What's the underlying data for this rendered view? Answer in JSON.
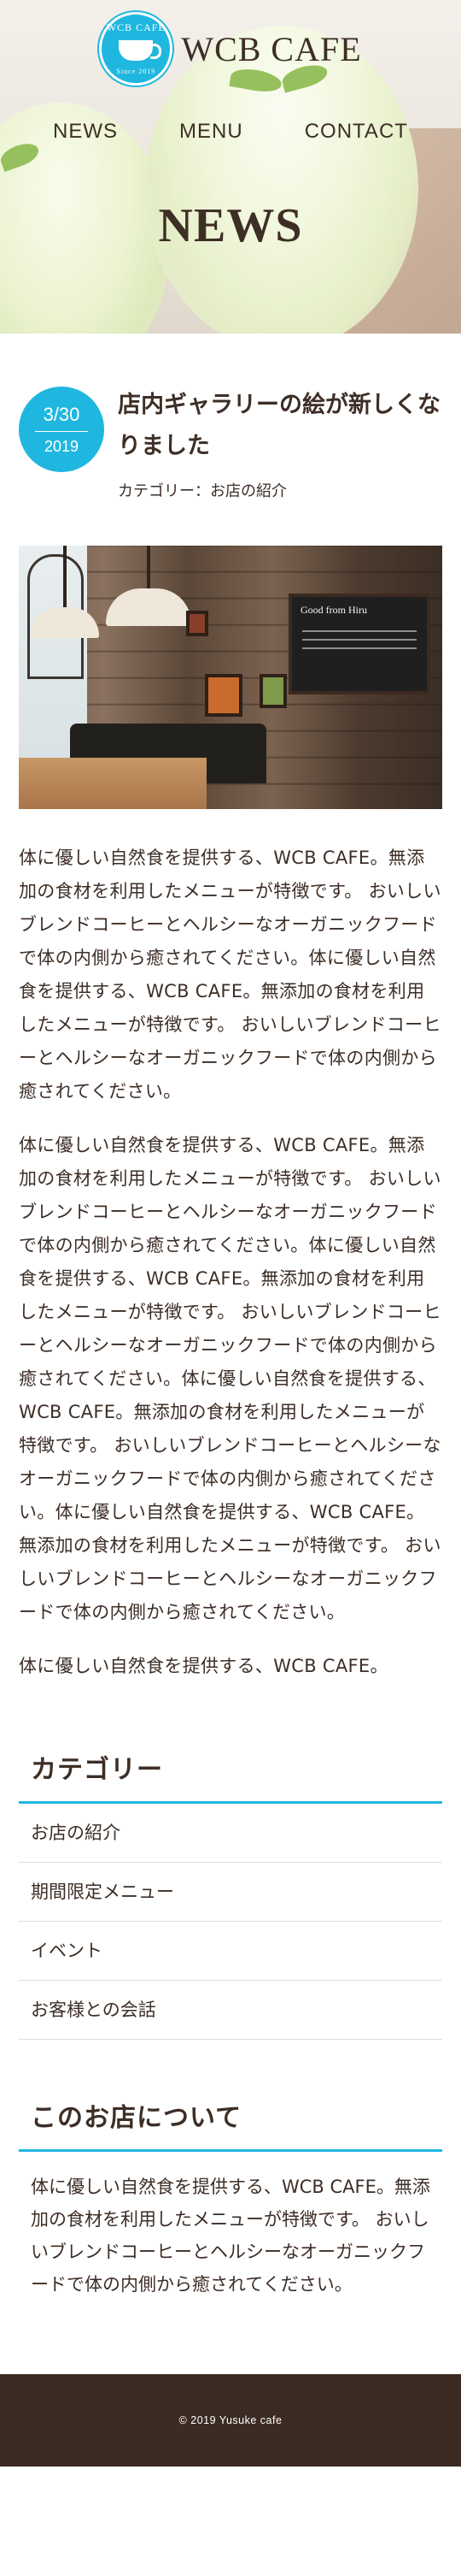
{
  "header": {
    "logo_text": "WCB CAFE",
    "logo_badge_top": "WCB CAFE",
    "logo_badge_bottom": "Since 2019",
    "nav": [
      "NEWS",
      "MENU",
      "CONTACT"
    ],
    "page_title": "NEWS"
  },
  "article": {
    "date_md": "3/30",
    "date_year": "2019",
    "title": "店内ギャラリーの絵が新しくなりました",
    "category_label": "カテゴリー：",
    "category_value": "お店の紹介",
    "photo_sign": "Good from Hiru",
    "paragraphs": [
      "体に優しい自然食を提供する、WCB CAFE。無添加の食材を利用したメニューが特徴です。 おいしいブレンドコーヒーとヘルシーなオーガニックフードで体の内側から癒されてください。体に優しい自然食を提供する、WCB CAFE。無添加の食材を利用したメニューが特徴です。 おいしいブレンドコーヒーとヘルシーなオーガニックフードで体の内側から癒されてください。",
      "体に優しい自然食を提供する、WCB CAFE。無添加の食材を利用したメニューが特徴です。 おいしいブレンドコーヒーとヘルシーなオーガニックフードで体の内側から癒されてください。体に優しい自然食を提供する、WCB CAFE。無添加の食材を利用したメニューが特徴です。 おいしいブレンドコーヒーとヘルシーなオーガニックフードで体の内側から癒されてください。体に優しい自然食を提供する、WCB CAFE。無添加の食材を利用したメニューが特徴です。 おいしいブレンドコーヒーとヘルシーなオーガニックフードで体の内側から癒されてください。体に優しい自然食を提供する、WCB CAFE。無添加の食材を利用したメニューが特徴です。 おいしいブレンドコーヒーとヘルシーなオーガニックフードで体の内側から癒されてください。",
      "体に優しい自然食を提供する、WCB CAFE。"
    ]
  },
  "sidebar": {
    "category_title": "カテゴリー",
    "categories": [
      "お店の紹介",
      "期間限定メニュー",
      "イベント",
      "お客様との会話"
    ],
    "about_title": "このお店について",
    "about_text": "体に優しい自然食を提供する、WCB CAFE。無添加の食材を利用したメニューが特徴です。 おいしいブレンドコーヒーとヘルシーなオーガニックフードで体の内側から癒されてください。"
  },
  "footer": {
    "copyright": "© 2019 Yusuke cafe"
  },
  "colors": {
    "accent": "#1fb7df",
    "text": "#3d2e26",
    "footer_bg": "#3c2b22"
  }
}
